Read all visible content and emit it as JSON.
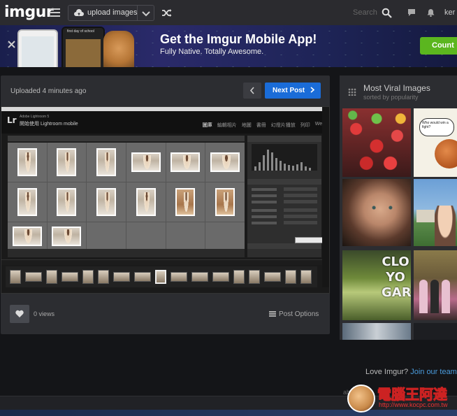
{
  "nav": {
    "logo": "imgur",
    "upload_label": "upload images",
    "search_label": "Search",
    "user_trunc": "ker"
  },
  "banner": {
    "title": "Get the Imgur Mobile App!",
    "subtitle": "Fully Native. Totally Awesome.",
    "cta_label": "Count",
    "phone_caption": "first day of school"
  },
  "post": {
    "uploaded": "Uploaded 4 minutes ago",
    "next_label": "Next Post",
    "views": "0 views",
    "options_label": "Post Options"
  },
  "lightroom": {
    "logo": "Lr",
    "product": "Adobe Lightroom 5",
    "subtitle": "開始使用 Lightroom mobile",
    "modules": [
      "圖庫",
      "編輯相片",
      "地圖",
      "書冊",
      "幻燈片播放",
      "列印",
      "Web"
    ]
  },
  "sidebar": {
    "title": "Most Viral Images",
    "subtitle": "sorted by popularity",
    "tile_word": "CLO\nYO\nGARD",
    "bubble_text": "Who would win a fight?"
  },
  "footer": {
    "love_prefix": "Love Imgur? ",
    "love_link": "Join our team",
    "about_trunc": "ab"
  },
  "watermark": {
    "title": "電腦王阿達",
    "url": "http://www.kocpc.com.tw"
  },
  "colors": {
    "nav_bg": "#2b2b2f",
    "panel_bg": "#2c2d31",
    "next_button": "#1a6cd8",
    "cta_green": "#5bb61f",
    "link_blue": "#4a9bdc"
  }
}
